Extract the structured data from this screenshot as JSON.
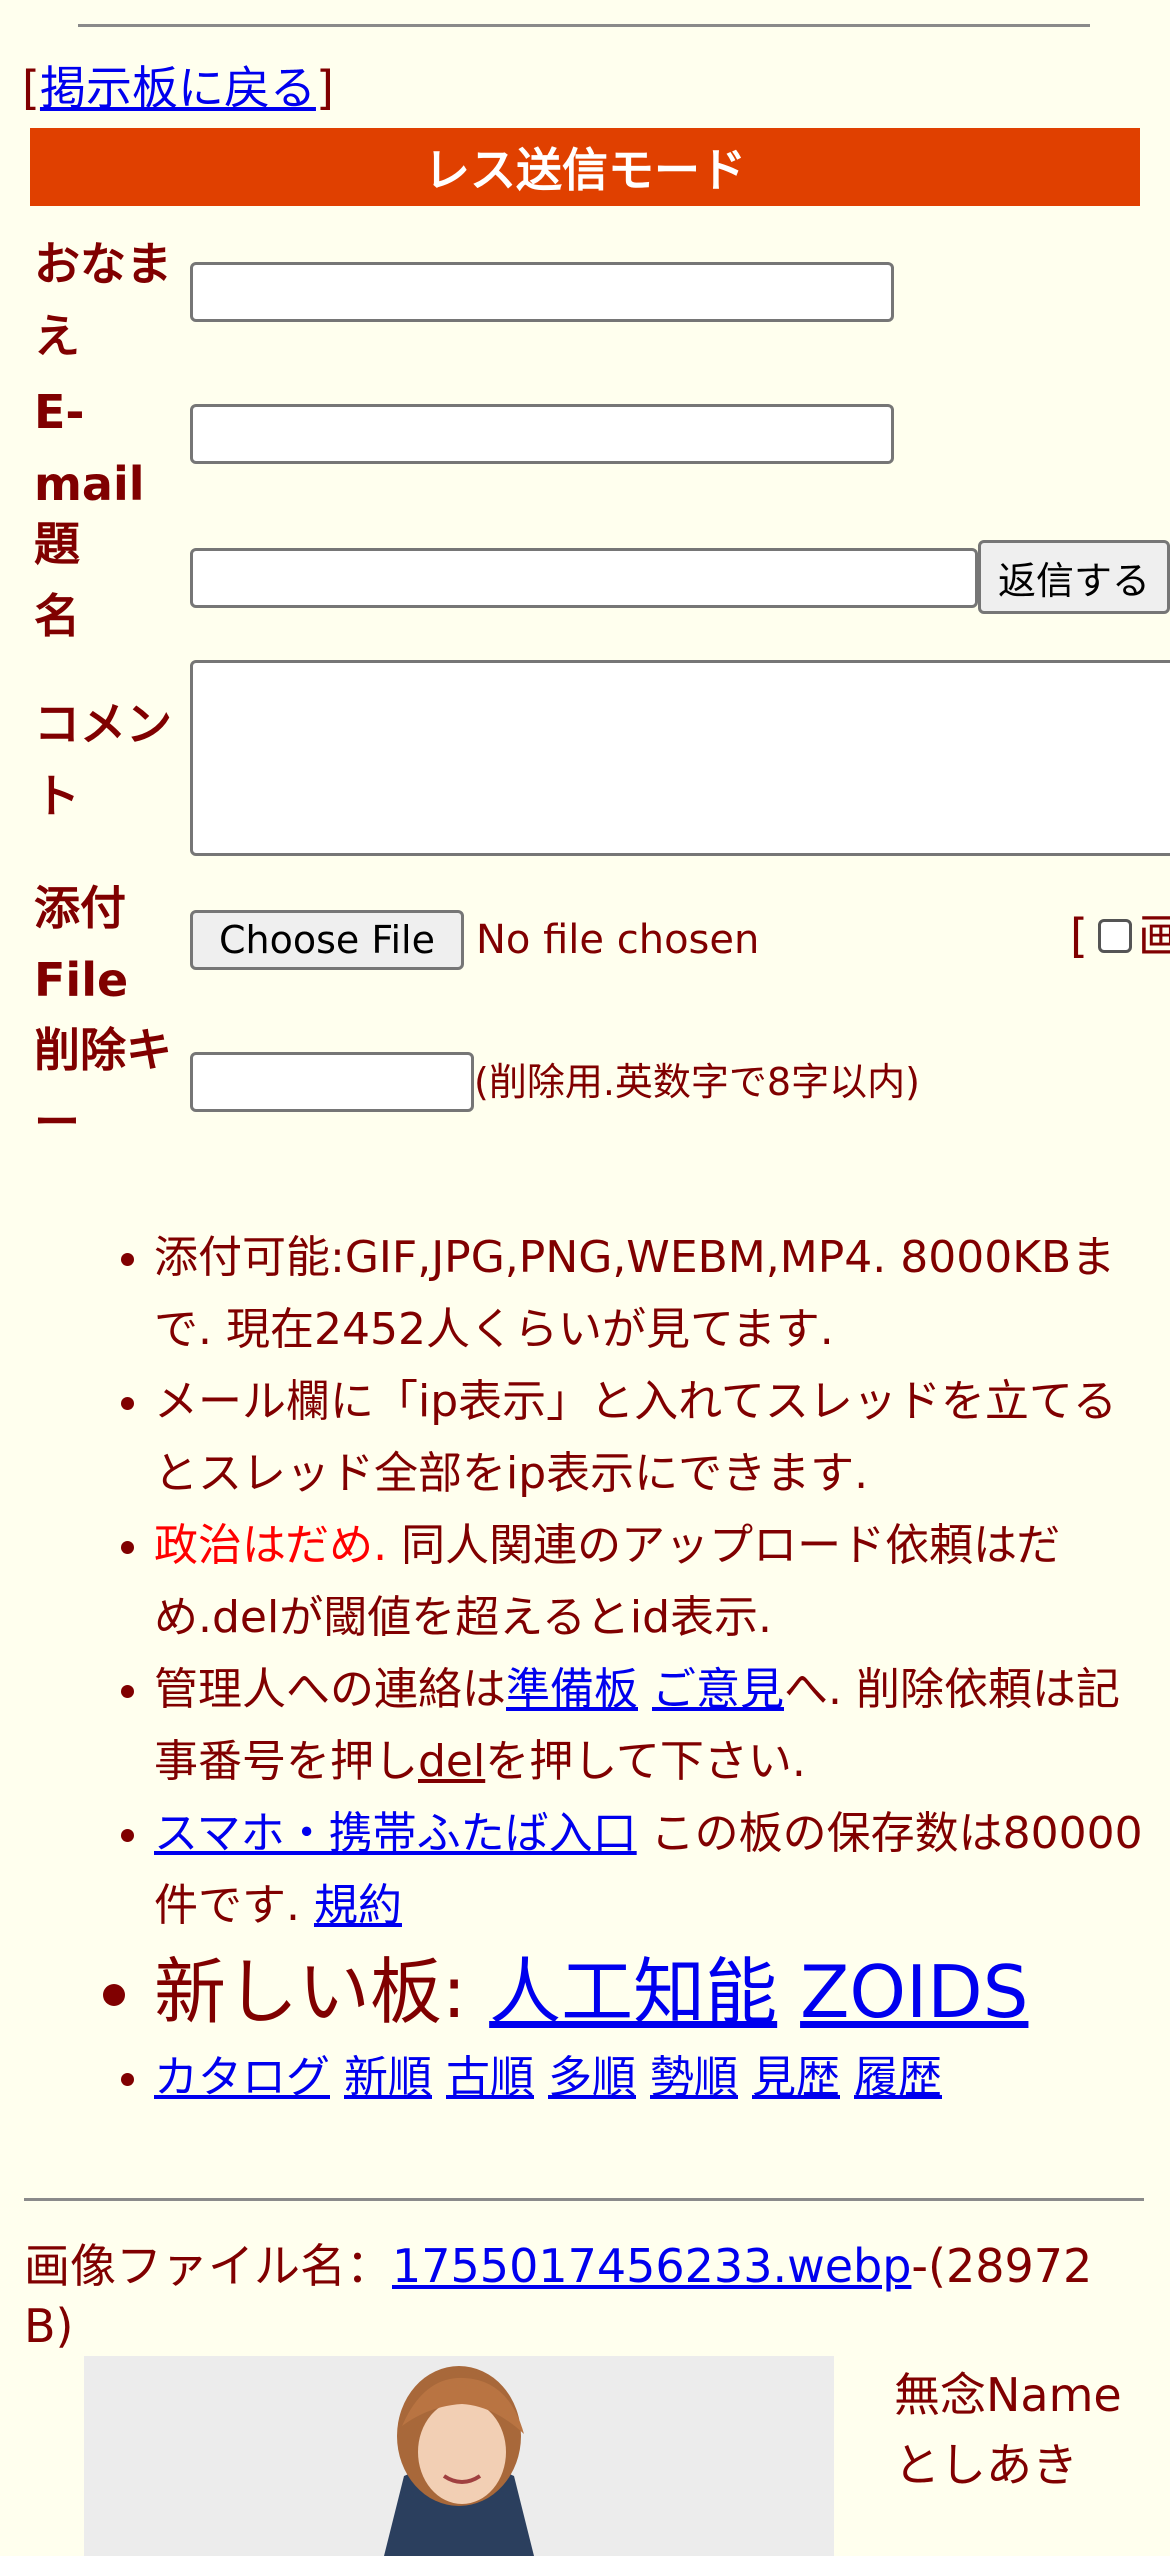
{
  "nav": {
    "bracket_open": "[",
    "back_link": "掲示板に戻る",
    "bracket_close": "]"
  },
  "banner": {
    "title": "レス送信モード"
  },
  "form": {
    "name_label": "おなまえ",
    "email_label": "E-mail",
    "subject_label": "題名",
    "submit_button": "返信する",
    "comment_label": "コメント",
    "file_label": "添付File",
    "choose_file_button": "Choose File",
    "no_file_text": "No file chosen",
    "image_checkbox_prefix": "[",
    "image_checkbox_label": "画",
    "delkey_label": "削除キー",
    "delkey_note": "(削除用.英数字で8字以内)",
    "name_value": "",
    "email_value": "",
    "subject_value": "",
    "comment_value": "",
    "delkey_value": ""
  },
  "rules": {
    "r1": "添付可能:GIF,JPG,PNG,WEBM,MP4. 8000KBまで. 現在2452人くらいが見てます.",
    "r2": "メール欄に「ip表示」と入れてスレッドを立てるとスレッド全部をip表示にできます.",
    "r3_red": "政治はだめ.",
    "r3_rest": " 同人関連のアップロード依頼はだめ.delが閾値を超えるとid表示.",
    "r4_a": "管理人への連絡は",
    "r4_link1": "準備板",
    "r4_link2": "ご意見",
    "r4_b": "へ. 削除依頼は記事番号を押し",
    "r4_link3": "del",
    "r4_c": "を押して下さい.",
    "r5_link": "スマホ・携帯ふたば入口",
    "r5_text": " この板の保存数は80000件です. ",
    "r5_link2": "規約",
    "new_boards_label": "新しい板: ",
    "new_board_1": "人工知能",
    "new_board_2": "ZOIDS",
    "sort_links": [
      "カタログ",
      "新順",
      "古順",
      "多順",
      "勢順",
      "見歴",
      "履歴"
    ]
  },
  "post": {
    "file_label": "画像ファイル名：",
    "file_link": "1755017456233.webp",
    "file_size": "-(28972 B)",
    "name_line_1": "無念Name",
    "name_line_2": "としあき"
  }
}
